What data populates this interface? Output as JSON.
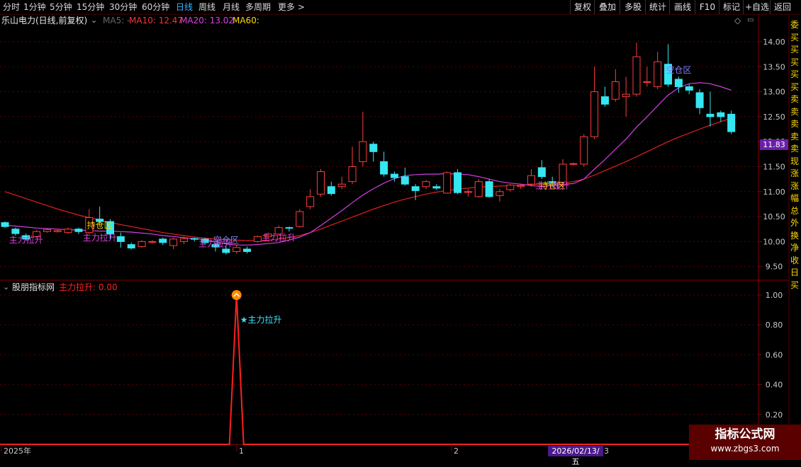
{
  "period_tabs": [
    "分时",
    "1分钟",
    "5分钟",
    "15分钟",
    "30分钟",
    "60分钟",
    "日线",
    "周线",
    "月线",
    "多周期",
    "更多 >"
  ],
  "active_period": "日线",
  "toolbar": [
    "复权",
    "叠加",
    "多股",
    "统计",
    "画线",
    "F10",
    "标记",
    "+自选",
    "返回"
  ],
  "stock_title": "乐山电力(日线,前复权)",
  "ma_labels": {
    "ma5": "MA5: -",
    "ma10": "MA10: 12.47",
    "ma20": "MA20: 13.02",
    "ma60": "MA60:"
  },
  "price_axis": [
    "14.00",
    "13.50",
    "13.00",
    "12.50",
    "12.00",
    "11.50",
    "11.00",
    "10.50",
    "10.00",
    "9.50"
  ],
  "current_price": "11.83",
  "indicator_title": "股朋指标网",
  "indicator_value": "主力拉升: 0.00",
  "indicator_axis": [
    "1.00",
    "0.80",
    "0.60",
    "0.40",
    "0.20"
  ],
  "indicator_signal": "★主力拉升",
  "indicator_signal_values": [
    0,
    0,
    0,
    0,
    0,
    0,
    0,
    0,
    0,
    0,
    0,
    0,
    0,
    0,
    0,
    0,
    0,
    0,
    0,
    0,
    0,
    0,
    1,
    0,
    0,
    0,
    0,
    0,
    0,
    0,
    0,
    0,
    0,
    0,
    0,
    0,
    0,
    0,
    0,
    0,
    0,
    0,
    0,
    0,
    0,
    0,
    0,
    0,
    0,
    0,
    0,
    0,
    0,
    0,
    0,
    0,
    0,
    0,
    0,
    0,
    0,
    0,
    0,
    0,
    0,
    0,
    0,
    0,
    0,
    0
  ],
  "date_axis": [
    "2025年",
    "1",
    "2",
    "3"
  ],
  "cursor_date": "2026/02/13/五",
  "annotations": [
    {
      "text": "主力拉升",
      "color": "#e040e0",
      "bar": 2,
      "price": 9.98
    },
    {
      "text": "主力拉升",
      "color": "#e040e0",
      "bar": 9,
      "price": 10.02
    },
    {
      "text": "持仓区",
      "color": "#ffd400",
      "bar": 9,
      "price": 10.27
    },
    {
      "text": "主力拉升",
      "color": "#e040e0",
      "bar": 20,
      "price": 9.9
    },
    {
      "text": "空仓区",
      "color": "#8080ff",
      "bar": 21,
      "price": 9.97
    },
    {
      "text": "主力拉升",
      "color": "#e040e0",
      "bar": 26,
      "price": 10.02
    },
    {
      "text": "持仓区",
      "color": "#ffd400",
      "bar": 52,
      "price": 11.06
    },
    {
      "text": "主力拉升",
      "color": "#e040e0",
      "bar": 52,
      "price": 11.06
    },
    {
      "text": "空仓区",
      "color": "#8080ff",
      "bar": 64,
      "price": 13.38
    }
  ],
  "chart_data": {
    "type": "candlestick",
    "price_ylim": [
      9.3,
      14.25
    ],
    "candles": [
      [
        10.38,
        10.3,
        10.4,
        10.27
      ],
      [
        10.25,
        10.16,
        10.28,
        10.12
      ],
      [
        10.12,
        10.05,
        10.16,
        10.02
      ],
      [
        10.1,
        10.2,
        10.23,
        10.08
      ],
      [
        10.2,
        10.24,
        10.27,
        10.18
      ],
      [
        10.2,
        10.22,
        10.25,
        10.18
      ],
      [
        10.18,
        10.25,
        10.28,
        10.15
      ],
      [
        10.25,
        10.2,
        10.28,
        10.15
      ],
      [
        10.18,
        10.48,
        10.65,
        10.15
      ],
      [
        10.45,
        10.4,
        10.7,
        10.3
      ],
      [
        10.4,
        10.15,
        10.45,
        10.05
      ],
      [
        10.1,
        10.0,
        10.18,
        9.88
      ],
      [
        9.94,
        9.87,
        9.98,
        9.84
      ],
      [
        9.9,
        10.0,
        10.03,
        9.88
      ],
      [
        10.0,
        10.0,
        10.03,
        9.96
      ],
      [
        10.05,
        9.98,
        10.08,
        9.93
      ],
      [
        9.92,
        10.05,
        10.08,
        9.85
      ],
      [
        10.0,
        10.06,
        10.1,
        9.95
      ],
      [
        10.06,
        10.05,
        10.08,
        10.0
      ],
      [
        10.05,
        9.98,
        10.07,
        9.93
      ],
      [
        9.94,
        9.89,
        9.98,
        9.8
      ],
      [
        9.85,
        9.78,
        9.92,
        9.74
      ],
      [
        9.8,
        9.88,
        9.94,
        9.76
      ],
      [
        9.85,
        9.8,
        9.9,
        9.76
      ],
      [
        10.0,
        10.1,
        10.12,
        9.98
      ],
      [
        10.1,
        10.15,
        10.18,
        10.05
      ],
      [
        10.15,
        10.28,
        10.32,
        10.12
      ],
      [
        10.28,
        10.27,
        10.3,
        10.2
      ],
      [
        10.3,
        10.6,
        10.65,
        10.28
      ],
      [
        10.7,
        10.9,
        11.05,
        10.65
      ],
      [
        10.95,
        11.4,
        11.45,
        10.9
      ],
      [
        11.1,
        10.96,
        11.2,
        10.92
      ],
      [
        11.1,
        11.15,
        11.3,
        11.05
      ],
      [
        11.2,
        11.5,
        11.9,
        11.15
      ],
      [
        11.6,
        12.0,
        12.6,
        11.5
      ],
      [
        11.95,
        11.8,
        12.0,
        11.6
      ],
      [
        11.6,
        11.35,
        11.8,
        11.3
      ],
      [
        11.35,
        11.28,
        11.4,
        11.2
      ],
      [
        11.3,
        11.15,
        11.48,
        11.12
      ],
      [
        11.1,
        11.02,
        11.15,
        10.83
      ],
      [
        11.1,
        11.2,
        11.23,
        11.05
      ],
      [
        11.1,
        11.07,
        11.15,
        11.03
      ],
      [
        10.97,
        11.38,
        11.4,
        10.96
      ],
      [
        11.38,
        10.98,
        11.45,
        10.95
      ],
      [
        11.0,
        11.0,
        11.05,
        10.9
      ],
      [
        10.9,
        11.2,
        11.25,
        10.88
      ],
      [
        11.2,
        10.9,
        11.25,
        10.88
      ],
      [
        10.92,
        11.0,
        11.05,
        10.8
      ],
      [
        11.04,
        11.13,
        11.15,
        11.0
      ],
      [
        11.1,
        11.12,
        11.15,
        11.05
      ],
      [
        11.15,
        11.32,
        11.45,
        11.1
      ],
      [
        11.48,
        11.3,
        11.63,
        11.25
      ],
      [
        11.2,
        11.18,
        11.3,
        11.1
      ],
      [
        11.15,
        11.55,
        11.65,
        11.1
      ],
      [
        11.55,
        11.56,
        11.58,
        11.52
      ],
      [
        11.55,
        12.1,
        12.15,
        11.5
      ],
      [
        12.1,
        13.0,
        13.5,
        12.05
      ],
      [
        12.9,
        12.75,
        13.1,
        12.7
      ],
      [
        12.85,
        13.2,
        13.45,
        12.8
      ],
      [
        12.9,
        12.95,
        13.3,
        12.5
      ],
      [
        12.95,
        13.7,
        13.98,
        12.9
      ],
      [
        13.2,
        13.2,
        13.5,
        13.1
      ],
      [
        13.1,
        13.6,
        13.8,
        13.05
      ],
      [
        13.55,
        13.15,
        13.95,
        13.1
      ],
      [
        13.25,
        13.1,
        13.3,
        12.98
      ],
      [
        13.1,
        13.03,
        13.15,
        12.95
      ],
      [
        12.98,
        12.68,
        13.05,
        12.55
      ],
      [
        12.55,
        12.5,
        13.0,
        12.3
      ],
      [
        12.58,
        12.5,
        12.62,
        12.4
      ],
      [
        12.55,
        12.2,
        12.62,
        12.15
      ]
    ],
    "ma10": [
      10.33,
      10.31,
      10.29,
      10.27,
      10.26,
      10.25,
      10.24,
      10.23,
      10.22,
      10.21,
      10.21,
      10.2,
      10.19,
      10.17,
      10.15,
      10.12,
      10.1,
      10.08,
      10.06,
      10.04,
      10.0,
      9.95,
      9.93,
      9.93,
      9.94,
      9.96,
      9.98,
      10.03,
      10.09,
      10.18,
      10.32,
      10.47,
      10.62,
      10.78,
      10.93,
      11.06,
      11.17,
      11.26,
      11.32,
      11.34,
      11.35,
      11.35,
      11.36,
      11.35,
      11.34,
      11.3,
      11.25,
      11.2,
      11.17,
      11.15,
      11.12,
      11.1,
      11.12,
      11.15,
      11.16,
      11.25,
      11.45,
      11.64,
      11.85,
      12.05,
      12.29,
      12.5,
      12.72,
      12.93,
      13.08,
      13.16,
      13.18,
      13.16,
      13.1,
      13.03
    ],
    "ma20": [
      11.0,
      10.93,
      10.86,
      10.79,
      10.72,
      10.65,
      10.59,
      10.53,
      10.48,
      10.43,
      10.38,
      10.34,
      10.3,
      10.26,
      10.22,
      10.18,
      10.15,
      10.12,
      10.09,
      10.07,
      10.05,
      10.04,
      10.03,
      10.02,
      10.02,
      10.03,
      10.05,
      10.08,
      10.12,
      10.18,
      10.25,
      10.33,
      10.41,
      10.49,
      10.57,
      10.65,
      10.72,
      10.79,
      10.85,
      10.9,
      10.95,
      10.99,
      11.02,
      11.05,
      11.07,
      11.09,
      11.1,
      11.11,
      11.12,
      11.13,
      11.14,
      11.15,
      11.16,
      11.17,
      11.2,
      11.25,
      11.33,
      11.42,
      11.51,
      11.6,
      11.7,
      11.8,
      11.9,
      12.0,
      12.09,
      12.17,
      12.25,
      12.33,
      12.4,
      12.47
    ]
  },
  "right_edge_chars": [
    "委",
    "买",
    "买",
    "买",
    "买",
    "买",
    "卖",
    "卖",
    "卖",
    "卖",
    "卖",
    "现",
    "涨",
    "涨",
    "幅",
    "总",
    "外",
    "换",
    "净",
    "收",
    "日",
    "买"
  ]
}
